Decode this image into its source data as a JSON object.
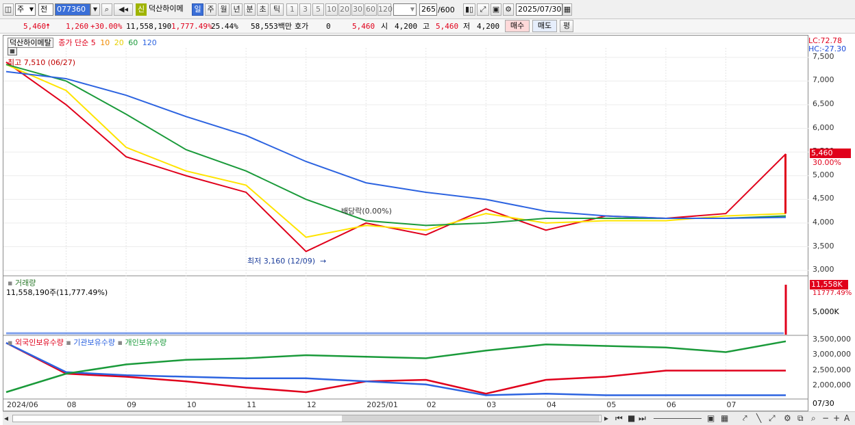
{
  "toolbar": {
    "dropdown1": "주",
    "dropdown2": "전",
    "code": "077360",
    "sin_badge": "신",
    "name": "덕산하이메",
    "period_tabs": [
      "일",
      "주",
      "월",
      "년",
      "분",
      "초",
      "틱"
    ],
    "selected_tab": "일",
    "nums": [
      "1",
      "3",
      "5",
      "10",
      "20",
      "30",
      "60",
      "120"
    ],
    "count": "265",
    "count_total": "/600",
    "date": "2025/07/30"
  },
  "quote": {
    "price": "5,460",
    "change": "1,260",
    "change_pct": "+30.00%",
    "volume": "11,558,190",
    "vol_ratio": "1,777.49%",
    "turnover": "25.44%",
    "amount": "58,553백만",
    "hoga_label": "호가",
    "hoga_val": "0",
    "si_val": "5,460",
    "si_label": "시",
    "open": "4,200",
    "go_label": "고",
    "high": "5,460",
    "jeo_label": "저",
    "low": "4,200",
    "buy_label": "매수",
    "sell_label": "매도",
    "avg_label": "평"
  },
  "price_pane": {
    "legend_name": "덕산하이메탈",
    "legend_type": "종가 단순",
    "ma_periods": [
      "5",
      "10",
      "20",
      "60",
      "120"
    ],
    "ma_colors": [
      "#e0001b",
      "#f08a00",
      "#ffe400",
      "#1a9a3a",
      "#2c63e0"
    ],
    "high_note": "최고 7,510 (06/27)",
    "low_note": "최저 3,160 (12/09)",
    "event_note": "배당락(0.00%)",
    "lc": "LC:72.78",
    "hc": "HC:-27.30",
    "y_ticks": [
      "7,500",
      "7,000",
      "6,500",
      "6,000",
      "5,500",
      "5,000",
      "4,500",
      "4,000",
      "3,500",
      "3,000"
    ],
    "current_price_tag": "5,460",
    "current_pct_tag": "30.00%"
  },
  "volume_pane": {
    "title": "거래량",
    "value_text": "11,558,190주(11,777.49%)",
    "y_tick": "5,000K",
    "tag": "11,558K",
    "tag_pct": "11777.49%"
  },
  "holding_pane": {
    "legend": [
      "외국인보유수량",
      "기관보유수량",
      "개인보유수량"
    ],
    "colors": [
      "#e0001b",
      "#2c63e0",
      "#1a9a3a"
    ],
    "y_ticks": [
      "3,500,000",
      "3,000,000",
      "2,500,000",
      "2,000,000"
    ]
  },
  "x_axis": {
    "labels": [
      "2024/06",
      "08",
      "09",
      "10",
      "11",
      "12",
      "2025/01",
      "02",
      "03",
      "04",
      "05",
      "06",
      "07"
    ],
    "end_label": "07/30"
  },
  "chart_data": {
    "type": "line",
    "title": "덕산하이메탈",
    "x": [
      "2024/06",
      "2024/08",
      "2024/09",
      "2024/10",
      "2024/11",
      "2024/12",
      "2025/01",
      "2025/02",
      "2025/03",
      "2025/04",
      "2025/05",
      "2025/06",
      "2025/07",
      "2025/07/30"
    ],
    "series": [
      {
        "name": "5",
        "values": [
          7400,
          6500,
          5400,
          5000,
          4650,
          3400,
          4000,
          3750,
          4300,
          3850,
          4150,
          4100,
          4200,
          5460
        ]
      },
      {
        "name": "20",
        "values": [
          7350,
          6800,
          5600,
          5100,
          4800,
          3700,
          3950,
          3850,
          4200,
          4000,
          4050,
          4050,
          4150,
          4200
        ]
      },
      {
        "name": "60",
        "values": [
          7350,
          7000,
          6300,
          5550,
          5100,
          4500,
          4050,
          3950,
          4000,
          4100,
          4100,
          4100,
          4100,
          4150
        ]
      },
      {
        "name": "120",
        "values": [
          7200,
          7050,
          6700,
          6250,
          5850,
          5300,
          4850,
          4650,
          4500,
          4250,
          4150,
          4100,
          4100,
          4120
        ]
      }
    ],
    "ylim": [
      2900,
      7700
    ],
    "volume": {
      "max_value": 11558190,
      "spike_x": "2025/07/30"
    },
    "holdings": {
      "foreign": [
        3400000,
        2400000,
        2300000,
        2150000,
        1950000,
        1800000,
        2150000,
        2200000,
        1750000,
        2200000,
        2300000,
        2500000,
        2500000,
        2500000
      ],
      "institution": [
        3400000,
        2450000,
        2350000,
        2300000,
        2250000,
        2250000,
        2150000,
        2050000,
        1700000,
        1750000,
        1700000,
        1700000,
        1700000,
        1700000
      ],
      "individual": [
        1800000,
        2400000,
        2700000,
        2850000,
        2900000,
        3000000,
        2950000,
        2900000,
        3150000,
        3350000,
        3300000,
        3250000,
        3100000,
        3450000
      ]
    }
  }
}
